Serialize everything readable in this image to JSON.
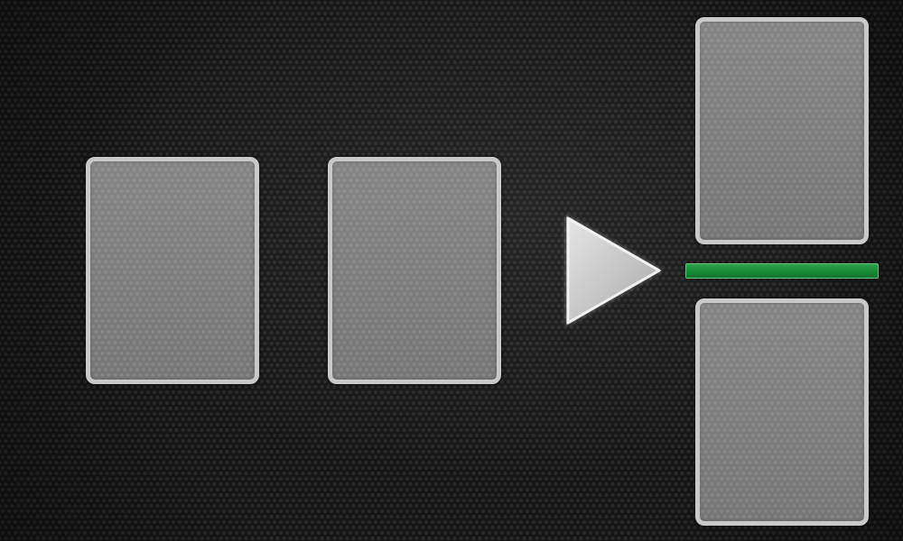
{
  "scene": {
    "background_color": "#161616",
    "card_slots": [
      {
        "id": "slot-1",
        "state": "empty"
      },
      {
        "id": "slot-2",
        "state": "empty"
      },
      {
        "id": "slot-3",
        "state": "empty"
      },
      {
        "id": "slot-4",
        "state": "empty"
      }
    ],
    "play_button": {
      "icon": "play-triangle-icon",
      "color": "#d6d6d6"
    },
    "divider_bar": {
      "color": "#1f9a3f"
    },
    "slot_border_color": "#c9c9c9",
    "slot_fill_color": "#7d7d7d"
  }
}
